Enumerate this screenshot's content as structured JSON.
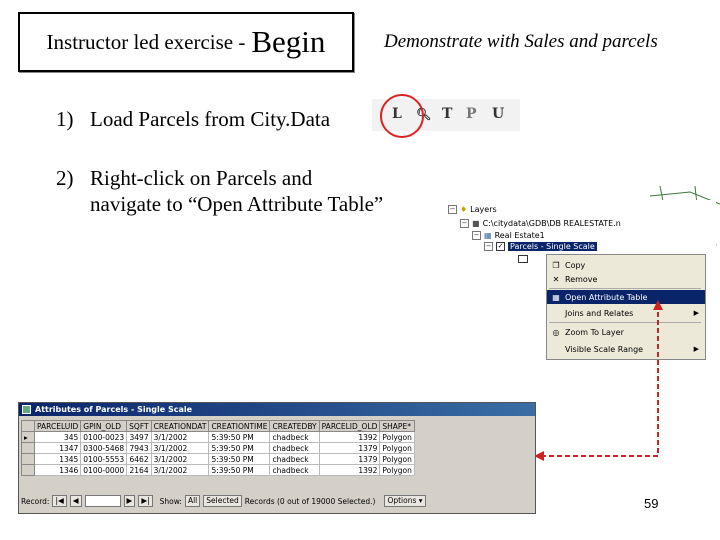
{
  "title": {
    "prefix": "Instructor led exercise - ",
    "emphasis": "Begin"
  },
  "subtitle": "Demonstrate with Sales and parcels",
  "steps": [
    {
      "number": "1)",
      "lines": [
        "Load Parcels from City.Data"
      ]
    },
    {
      "number": "2)",
      "lines": [
        "Right-click on Parcels and",
        "navigate to “Open Attribute Table”"
      ]
    }
  ],
  "toolbar": {
    "letters": [
      "L",
      "T",
      "P",
      "U"
    ],
    "search_icon": "magnifier-icon",
    "highlight_color": "#d22222"
  },
  "toc": {
    "root": "Layers",
    "database": "C:\\citydata\\GDB\\DB REALESTATE.n",
    "group": "Real Estate1",
    "layer": "Parcels - Single Scale"
  },
  "context_menu": {
    "items": [
      {
        "icon": "copy-icon",
        "label": "Copy"
      },
      {
        "icon": "remove-icon",
        "label": "Remove"
      },
      {
        "icon": "table-icon",
        "label": "Open Attribute Table",
        "highlighted": true
      },
      {
        "icon": "",
        "label": "Joins and Relates",
        "submenu": true
      },
      {
        "icon": "zoom-to-layer-icon",
        "label": "Zoom To Layer"
      },
      {
        "icon": "",
        "label": "Visible Scale Range",
        "submenu": true
      }
    ]
  },
  "attribute_window": {
    "title": "Attributes of Parcels - Single Scale",
    "columns": [
      "PARCELUID",
      "GPIN_OLD",
      "SQFT",
      "CREATIONDAT",
      "CREATIONTIME",
      "CREATEDBY",
      "PARCELID_OLD",
      "SHAPE*"
    ],
    "rows": [
      [
        "345",
        "0100-0023",
        "3497",
        "3/1/2002",
        "5:39:50 PM",
        "chadbeck",
        "1392",
        "Polygon"
      ],
      [
        "1347",
        "0300-5468",
        "7943",
        "3/1/2002",
        "5:39:50 PM",
        "chadbeck",
        "1379",
        "Polygon"
      ],
      [
        "1345",
        "0100-5553",
        "6462",
        "3/1/2002",
        "5:39:50 PM",
        "chadbeck",
        "1379",
        "Polygon"
      ],
      [
        "1346",
        "0100-0000",
        "2164",
        "3/1/2002",
        "5:39:50 PM",
        "chadbeck",
        "1392",
        "Polygon"
      ]
    ],
    "status": {
      "record_label": "Record:",
      "show_label": "Show:",
      "all_label": "All",
      "selected_label": "Selected",
      "records_text": "Records (0 out of 19000 Selected.)",
      "options_label": "Options"
    }
  },
  "page_number": "59",
  "colors": {
    "arrow": "#cc2222",
    "menu_highlight": "#0a246a"
  }
}
